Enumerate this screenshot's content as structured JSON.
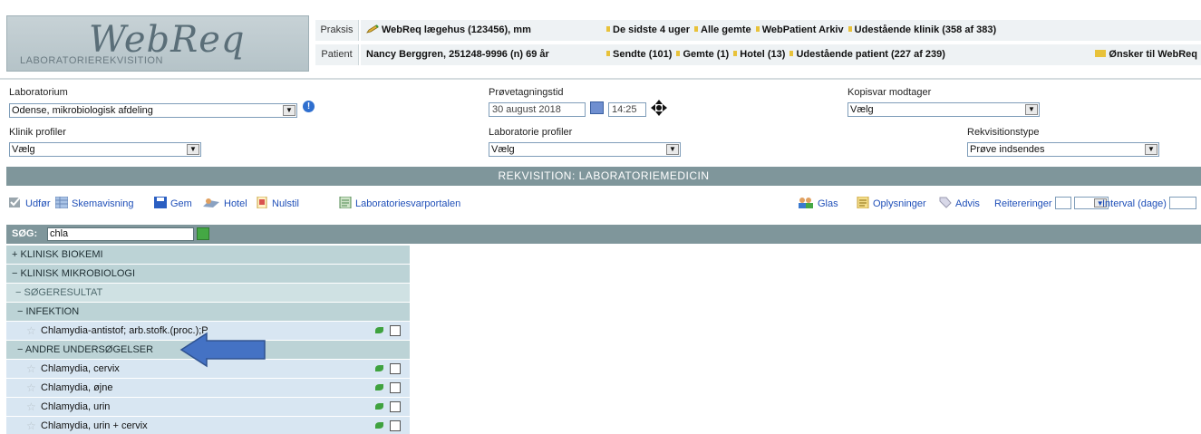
{
  "header": {
    "logo_title": "WebReq",
    "logo_subtitle": "LABORATORIEREKVISITION",
    "praksis_label": "Praksis",
    "praksis_value": "WebReq lægehus (123456), mm",
    "patient_label": "Patient",
    "patient_value": "Nancy Berggren, 251248-9996 (n)  69 år",
    "links_row1": [
      "De sidste 4 uger",
      "Alle gemte",
      "WebPatient Arkiv",
      "Udestående klinik (358 af 383)"
    ],
    "links_row2": [
      "Sendte (101)",
      "Gemte (1)",
      "Hotel (13)",
      "Udestående patient (227 af 239)"
    ],
    "wishes_label": "Ønsker til WebReq"
  },
  "form": {
    "laboratorium_label": "Laboratorium",
    "laboratorium_value": "Odense, mikrobiologisk afdeling",
    "provetagningstid_label": "Prøvetagningstid",
    "date_value": "30 august 2018",
    "time_value": "14:25",
    "kopisvar_label": "Kopisvar modtager",
    "kopisvar_value": "Vælg",
    "klinik_label": "Klinik profiler",
    "klinik_value": "Vælg",
    "labprofiler_label": "Laboratorie profiler",
    "labprofiler_value": "Vælg",
    "rekvisitionstype_label": "Rekvisitionstype",
    "rekvisitionstype_value": "Prøve indsendes"
  },
  "title_band": "REKVISITION: LABORATORIEMEDICIN",
  "toolbar": {
    "udfor": "Udfør",
    "skemavisning": "Skemavisning",
    "gem": "Gem",
    "hotel": "Hotel",
    "nulstil": "Nulstil",
    "laboratoriesvarportalen": "Laboratoriesvarportalen",
    "glas": "Glas",
    "oplysninger": "Oplysninger",
    "advis": "Advis",
    "reitereringer": "Reitereringer",
    "interval": "Interval (dage)"
  },
  "search": {
    "label": "SØG:",
    "value": "chla"
  },
  "tree": {
    "klinisk_biokemi": "+ KLINISK BIOKEMI",
    "klinisk_mikrobiologi": "− KLINISK MIKROBIOLOGI",
    "sogeresultat": "−   SØGERESULTAT",
    "infektion": "− INFEKTION",
    "andre": "− ANDRE UNDERSØGELSER",
    "items": [
      "Chlamydia-antistof; arb.stofk.(proc.);P",
      "Chlamydia, cervix",
      "Chlamydia, øjne",
      "Chlamydia, urin",
      "Chlamydia, urin + cervix"
    ]
  },
  "colors": {
    "band": "#7f969b",
    "category_row": "#bcd3d6",
    "item_row": "#d8e6f2",
    "link_blue": "#1f4fb8",
    "arrow_blue": "#4472c4"
  }
}
